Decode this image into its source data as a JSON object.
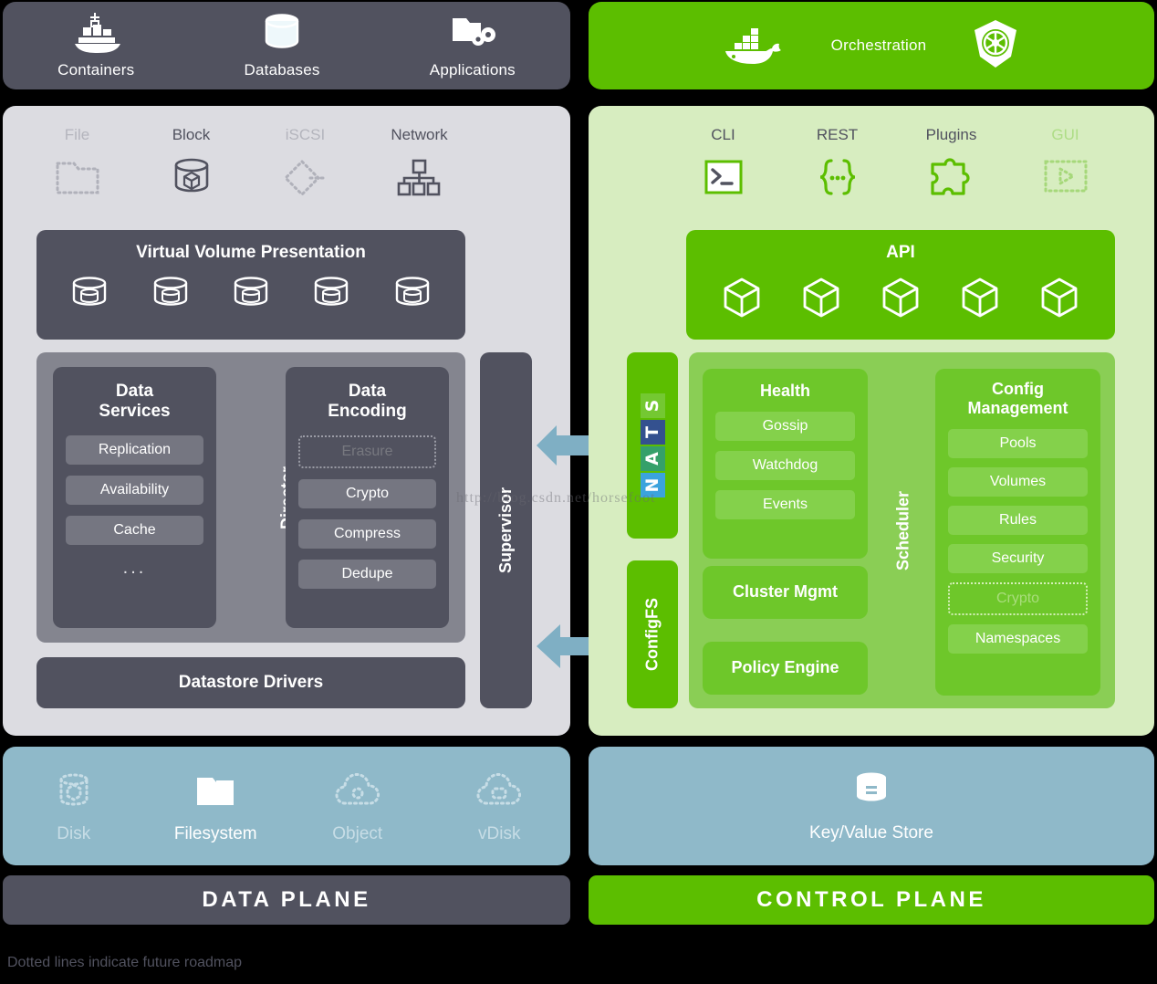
{
  "top_left_bar": {
    "items": [
      {
        "label": "Containers",
        "icon": "container-ship-icon"
      },
      {
        "label": "Databases",
        "icon": "database-cylinder-icon"
      },
      {
        "label": "Applications",
        "icon": "folder-gears-icon"
      }
    ]
  },
  "top_right_bar": {
    "label": "Orchestration",
    "left_icon": "docker-whale-icon",
    "right_icon": "kubernetes-helm-icon"
  },
  "data_plane": {
    "protocols": [
      {
        "label": "File",
        "icon": "folder-dotted-icon",
        "future": true
      },
      {
        "label": "Block",
        "icon": "block-cylinder-icon",
        "future": false
      },
      {
        "label": "iSCSI",
        "icon": "iscsi-diamond-dotted-icon",
        "future": true
      },
      {
        "label": "Network",
        "icon": "network-tree-icon",
        "future": false
      }
    ],
    "virtual_volume": {
      "title": "Virtual Volume Presentation",
      "volume_count": 5,
      "volume_icon": "volume-cylinder-icon"
    },
    "director_label": "Director",
    "data_services": {
      "title": "Data\nServices",
      "title_line1": "Data",
      "title_line2": "Services",
      "items": [
        {
          "label": "Replication",
          "future": false
        },
        {
          "label": "Availability",
          "future": false
        },
        {
          "label": "Cache",
          "future": false
        }
      ],
      "ellipsis": "..."
    },
    "data_encoding": {
      "title_line1": "Data",
      "title_line2": "Encoding",
      "items": [
        {
          "label": "Erasure",
          "future": true
        },
        {
          "label": "Crypto",
          "future": false
        },
        {
          "label": "Compress",
          "future": false
        },
        {
          "label": "Dedupe",
          "future": false
        }
      ]
    },
    "datastore_drivers": "Datastore Drivers",
    "supervisor_label": "Supervisor"
  },
  "control_plane": {
    "interfaces": [
      {
        "label": "CLI",
        "icon": "terminal-prompt-icon",
        "future": false
      },
      {
        "label": "REST",
        "icon": "curly-braces-icon",
        "future": false
      },
      {
        "label": "Plugins",
        "icon": "puzzle-piece-icon",
        "future": false
      },
      {
        "label": "GUI",
        "icon": "gui-play-dotted-icon",
        "future": true
      }
    ],
    "api": {
      "title": "API",
      "cube_count": 5,
      "cube_icon": "cube-icon"
    },
    "nats": {
      "name": "NATS",
      "letters": [
        {
          "char": "N",
          "color": "#3ba3dd"
        },
        {
          "char": "A",
          "color": "#35a06a"
        },
        {
          "char": "T",
          "color": "#34518f"
        },
        {
          "char": "S",
          "color": "#74c832"
        }
      ]
    },
    "configfs_label": "ConfigFS",
    "scheduler_label": "Scheduler",
    "health": {
      "title": "Health",
      "items": [
        {
          "label": "Gossip",
          "future": false
        },
        {
          "label": "Watchdog",
          "future": false
        },
        {
          "label": "Events",
          "future": false
        }
      ]
    },
    "cluster_mgmt": "Cluster Mgmt",
    "policy_engine": "Policy Engine",
    "config_management": {
      "title_line1": "Config",
      "title_line2": "Management",
      "items": [
        {
          "label": "Pools",
          "future": false
        },
        {
          "label": "Volumes",
          "future": false
        },
        {
          "label": "Rules",
          "future": false
        },
        {
          "label": "Security",
          "future": false
        },
        {
          "label": "Crypto",
          "future": true
        },
        {
          "label": "Namespaces",
          "future": false
        }
      ]
    }
  },
  "backends_left": {
    "items": [
      {
        "label": "Disk",
        "icon": "disk-dotted-icon",
        "future": true
      },
      {
        "label": "Filesystem",
        "icon": "folder-solid-icon",
        "future": false
      },
      {
        "label": "Object",
        "icon": "cloud-object-dotted-icon",
        "future": true
      },
      {
        "label": "vDisk",
        "icon": "cloud-vdisk-dotted-icon",
        "future": true
      }
    ]
  },
  "backends_right": {
    "label": "Key/Value Store",
    "icon": "keyvalue-cylinder-icon"
  },
  "plane_labels": {
    "data": "DATA PLANE",
    "control": "CONTROL PLANE"
  },
  "footnote": "Dotted lines indicate future roadmap",
  "watermark": "http://blog.csdn.net/horsefoot",
  "colors": {
    "dark_slate": "#51525f",
    "light_gray_panel": "#dcdce1",
    "brand_green": "#5cbe00",
    "light_green_panel": "#d7edc0",
    "mid_green": "#8ace55",
    "chip_gray": "#757681",
    "chip_green": "#84d14b",
    "backend_blue": "#8fb9c9",
    "arrow_blue": "#7fafc4"
  }
}
